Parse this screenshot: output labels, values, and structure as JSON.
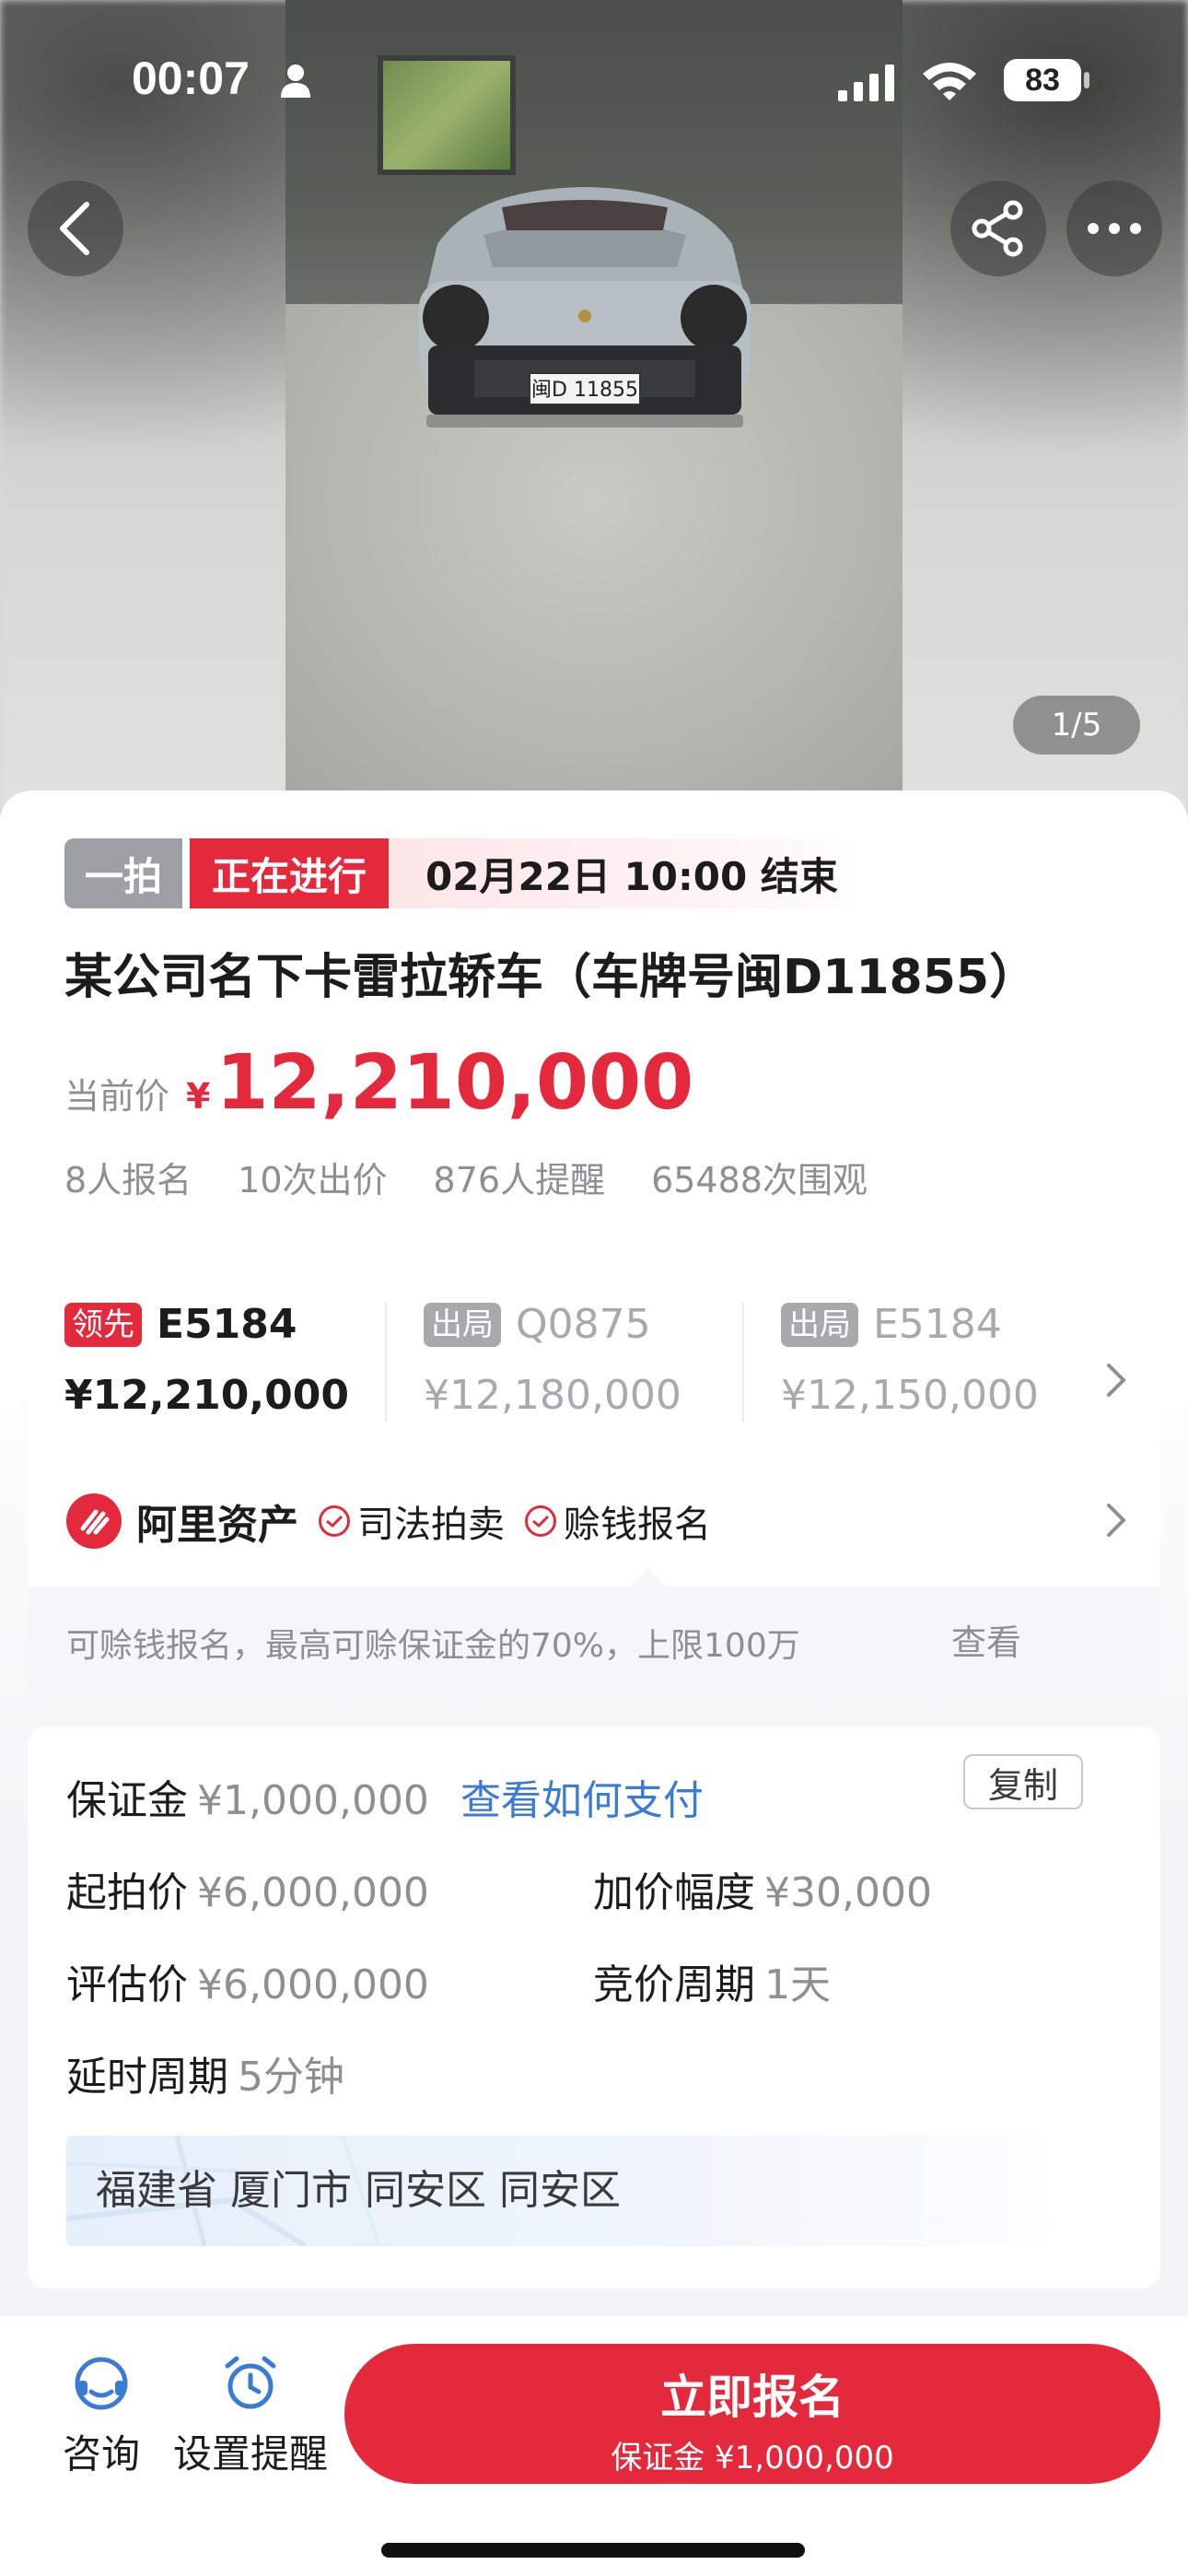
{
  "status_bar": {
    "time": "00:07",
    "battery": "83",
    "icons": [
      "person-icon",
      "signal-icon",
      "wifi-icon",
      "battery-icon"
    ]
  },
  "hero": {
    "photo_counter": "1/5",
    "plate": "闽D 11855",
    "buttons": [
      "back-icon",
      "share-icon",
      "more-icon"
    ]
  },
  "auction": {
    "round_tag": "一拍",
    "status_tag": "正在进行",
    "end_time": "02月22日 10:00 结束",
    "title": "某公司名下卡雷拉轿车（车牌号闽D11855）",
    "price_label": "当前价",
    "currency": "¥",
    "current_price": "12,210,000",
    "stats": [
      "8人报名",
      "10次出价",
      "876人提醒",
      "65488次围观"
    ]
  },
  "bids": [
    {
      "badge": "领先",
      "code": "E5184",
      "amount": "¥12,210,000",
      "state": "lead"
    },
    {
      "badge": "出局",
      "code": "Q0875",
      "amount": "¥12,180,000",
      "state": "out"
    },
    {
      "badge": "出局",
      "code": "E5184",
      "amount": "¥12,150,000",
      "state": "out"
    }
  ],
  "ali": {
    "brand": "阿里资产",
    "tags": [
      "司法拍卖",
      "赊钱报名"
    ],
    "note": "可赊钱报名，最高可赊保证金的70%，上限100万",
    "view_label": "查看"
  },
  "details": {
    "deposit_label": "保证金",
    "deposit_value": "¥1,000,000",
    "pay_link": "查看如何支付",
    "start_label": "起拍价",
    "start_value": "¥6,000,000",
    "increment_label": "加价幅度",
    "increment_value": "¥30,000",
    "appraisal_label": "评估价",
    "appraisal_value": "¥6,000,000",
    "cycle_label": "竞价周期",
    "cycle_value": "1天",
    "delay_label": "延时周期",
    "delay_value": "5分钟",
    "address": "福建省 厦门市 同安区 同安区",
    "copy_label": "复制"
  },
  "bottom": {
    "consult_label": "咨询",
    "reminder_label": "设置提醒",
    "signup_label": "立即报名",
    "signup_sub": "保证金 ¥1,000,000"
  },
  "colors": {
    "accent": "#e5293d",
    "link": "#3a7bd5",
    "muted": "#8e8e93"
  }
}
